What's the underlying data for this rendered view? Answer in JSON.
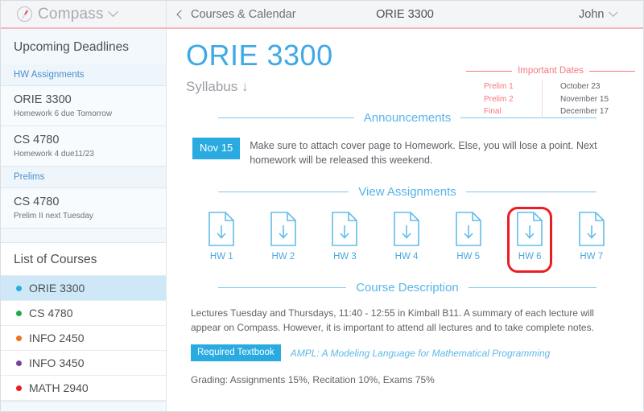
{
  "brand": {
    "name": "Compass",
    "icon": "compass-icon",
    "dropdown_icon": "chevron-down-icon"
  },
  "topbar": {
    "back_label": "Courses & Calendar",
    "back_icon": "chevron-left-icon",
    "title": "ORIE 3300",
    "user_label": "John",
    "user_dropdown_icon": "chevron-down-icon"
  },
  "sidebar": {
    "deadlines_title": "Upcoming Deadlines",
    "hw_section_label": "HW Assignments",
    "hw_deadlines": [
      {
        "course": "ORIE 3300",
        "note": "Homework 6 due Tomorrow"
      },
      {
        "course": "CS 4780",
        "note": "Homework 4 due11/23"
      }
    ],
    "prelims_section_label": "Prelims",
    "prelim_deadlines": [
      {
        "course": "CS 4780",
        "note": "Prelim II next Tuesday"
      }
    ],
    "courses_title": "List of Courses",
    "courses": [
      {
        "name": "ORIE 3300",
        "color": "#29abe2",
        "active": true
      },
      {
        "name": "CS 4780",
        "color": "#22a74a",
        "active": false
      },
      {
        "name": "INFO 2450",
        "color": "#f0711f",
        "active": false
      },
      {
        "name": "INFO 3450",
        "color": "#7b3fa0",
        "active": false
      },
      {
        "name": "MATH 2940",
        "color": "#ed1c24",
        "active": false
      }
    ]
  },
  "main": {
    "page_title": "ORIE 3300",
    "syllabus_label": "Syllabus ↓",
    "important_dates": {
      "heading": "Important Dates",
      "rows": [
        {
          "label": "Prelim 1",
          "date": "October 23"
        },
        {
          "label": "Prelim 2",
          "date": "November 15"
        },
        {
          "label": "Final",
          "date": "December 17"
        }
      ]
    },
    "announcements": {
      "heading": "Announcements",
      "items": [
        {
          "date_badge": "Nov 15",
          "text": "Make sure to attach cover page to Homework. Else, you will lose a point. Next homework will be released this weekend."
        }
      ]
    },
    "assignments": {
      "heading": "View Assignments",
      "items": [
        {
          "label": "HW 1",
          "icon": "download-document-icon",
          "highlighted": false
        },
        {
          "label": "HW 2",
          "icon": "download-document-icon",
          "highlighted": false
        },
        {
          "label": "HW 3",
          "icon": "download-document-icon",
          "highlighted": false
        },
        {
          "label": "HW 4",
          "icon": "download-document-icon",
          "highlighted": false
        },
        {
          "label": "HW 5",
          "icon": "download-document-icon",
          "highlighted": false
        },
        {
          "label": "HW 6",
          "icon": "download-document-icon",
          "highlighted": true
        },
        {
          "label": "HW 7",
          "icon": "download-document-icon",
          "highlighted": false
        }
      ],
      "highlight_color": "#ed1c24"
    },
    "course_description": {
      "heading": "Course Description",
      "body": "Lectures Tuesday and Thursdays, 11:40 - 12:55 in Kimball B11. A summary of each lecture will appear on Compass. However, it is important to attend all lectures and to take complete notes.",
      "textbook_badge": "Required Textbook",
      "textbook_title": "AMPL: A Modeling Language for Mathematical Programming",
      "grading": "Grading: Assignments 15%, Recitation 10%, Exams 75%"
    }
  },
  "colors": {
    "accent_blue": "#29abe2",
    "light_blue": "#57b5e8",
    "salmon": "#f4777f",
    "highlight_red": "#ed1c24"
  }
}
